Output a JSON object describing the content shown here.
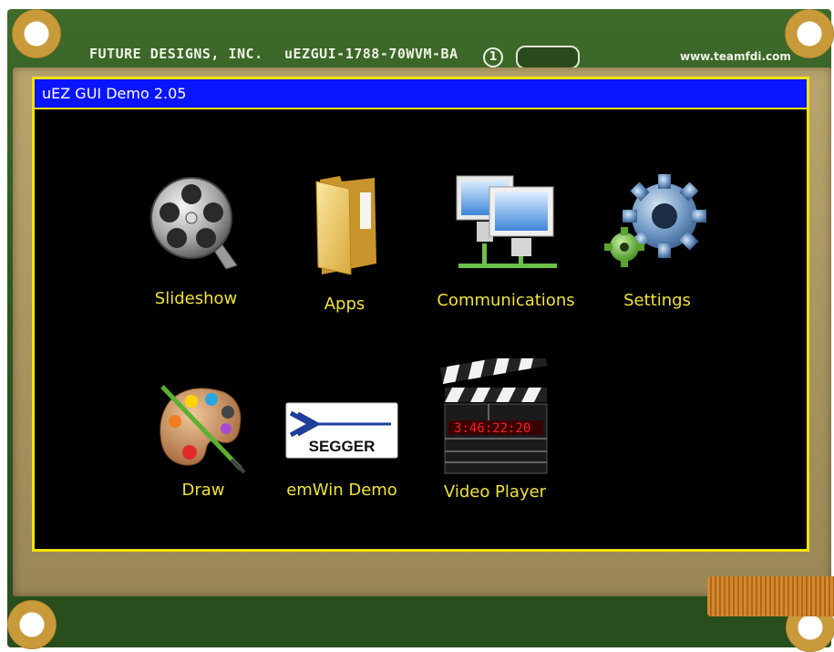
{
  "board": {
    "silk_left": "FUTURE DESIGNS, INC.",
    "silk_model": "uEZGUI-1788-70WVM-BA",
    "silk_rev": "1",
    "silk_url": "www.teamfdi.com"
  },
  "window": {
    "title": "uEZ GUI Demo 2.05"
  },
  "colors": {
    "titlebar": "#0a14ff",
    "frame": "#f4e200",
    "label": "#f0e23a",
    "background": "#000000"
  },
  "apps": [
    {
      "label": "Slideshow",
      "icon": "film-reel-icon"
    },
    {
      "label": "Apps",
      "icon": "folder-icon"
    },
    {
      "label": "Communications",
      "icon": "network-computers-icon"
    },
    {
      "label": "Settings",
      "icon": "gears-icon"
    },
    {
      "label": "Draw",
      "icon": "paint-palette-icon"
    },
    {
      "label": "emWin Demo",
      "icon": "segger-logo-icon"
    },
    {
      "label": "Video Player",
      "icon": "clapperboard-icon"
    }
  ]
}
